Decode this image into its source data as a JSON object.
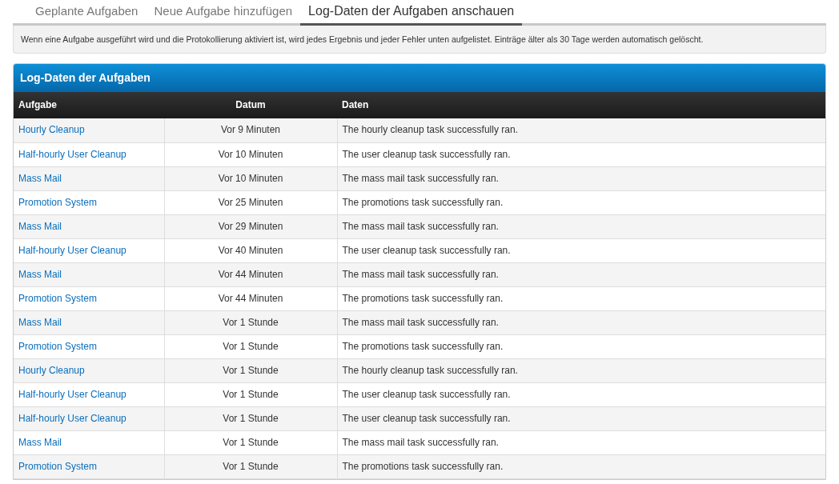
{
  "tabs": [
    {
      "label": "Geplante Aufgaben",
      "selected": false
    },
    {
      "label": "Neue Aufgabe hinzufügen",
      "selected": false
    },
    {
      "label": "Log-Daten der Aufgaben anschauen",
      "selected": true
    }
  ],
  "notice": "Wenn eine Aufgabe ausgeführt wird und die Protokollierung aktiviert ist, wird jedes Ergebnis und jeder Fehler unten aufgelistet. Einträge älter als 30 Tage werden automatisch gelöscht.",
  "panel": {
    "title": "Log-Daten der Aufgaben",
    "columns": [
      "Aufgabe",
      "Datum",
      "Daten"
    ],
    "rows": [
      {
        "task": "Hourly Cleanup",
        "date": "Vor 9 Minuten",
        "data": "The hourly cleanup task successfully ran."
      },
      {
        "task": "Half-hourly User Cleanup",
        "date": "Vor 10 Minuten",
        "data": "The user cleanup task successfully ran."
      },
      {
        "task": "Mass Mail",
        "date": "Vor 10 Minuten",
        "data": "The mass mail task successfully ran."
      },
      {
        "task": "Promotion System",
        "date": "Vor 25 Minuten",
        "data": "The promotions task successfully ran."
      },
      {
        "task": "Mass Mail",
        "date": "Vor 29 Minuten",
        "data": "The mass mail task successfully ran."
      },
      {
        "task": "Half-hourly User Cleanup",
        "date": "Vor 40 Minuten",
        "data": "The user cleanup task successfully ran."
      },
      {
        "task": "Mass Mail",
        "date": "Vor 44 Minuten",
        "data": "The mass mail task successfully ran."
      },
      {
        "task": "Promotion System",
        "date": "Vor 44 Minuten",
        "data": "The promotions task successfully ran."
      },
      {
        "task": "Mass Mail",
        "date": "Vor 1 Stunde",
        "data": "The mass mail task successfully ran."
      },
      {
        "task": "Promotion System",
        "date": "Vor 1 Stunde",
        "data": "The promotions task successfully ran."
      },
      {
        "task": "Hourly Cleanup",
        "date": "Vor 1 Stunde",
        "data": "The hourly cleanup task successfully ran."
      },
      {
        "task": "Half-hourly User Cleanup",
        "date": "Vor 1 Stunde",
        "data": "The user cleanup task successfully ran."
      },
      {
        "task": "Half-hourly User Cleanup",
        "date": "Vor 1 Stunde",
        "data": "The user cleanup task successfully ran."
      },
      {
        "task": "Mass Mail",
        "date": "Vor 1 Stunde",
        "data": "The mass mail task successfully ran."
      },
      {
        "task": "Promotion System",
        "date": "Vor 1 Stunde",
        "data": "The promotions task successfully ran."
      }
    ]
  }
}
